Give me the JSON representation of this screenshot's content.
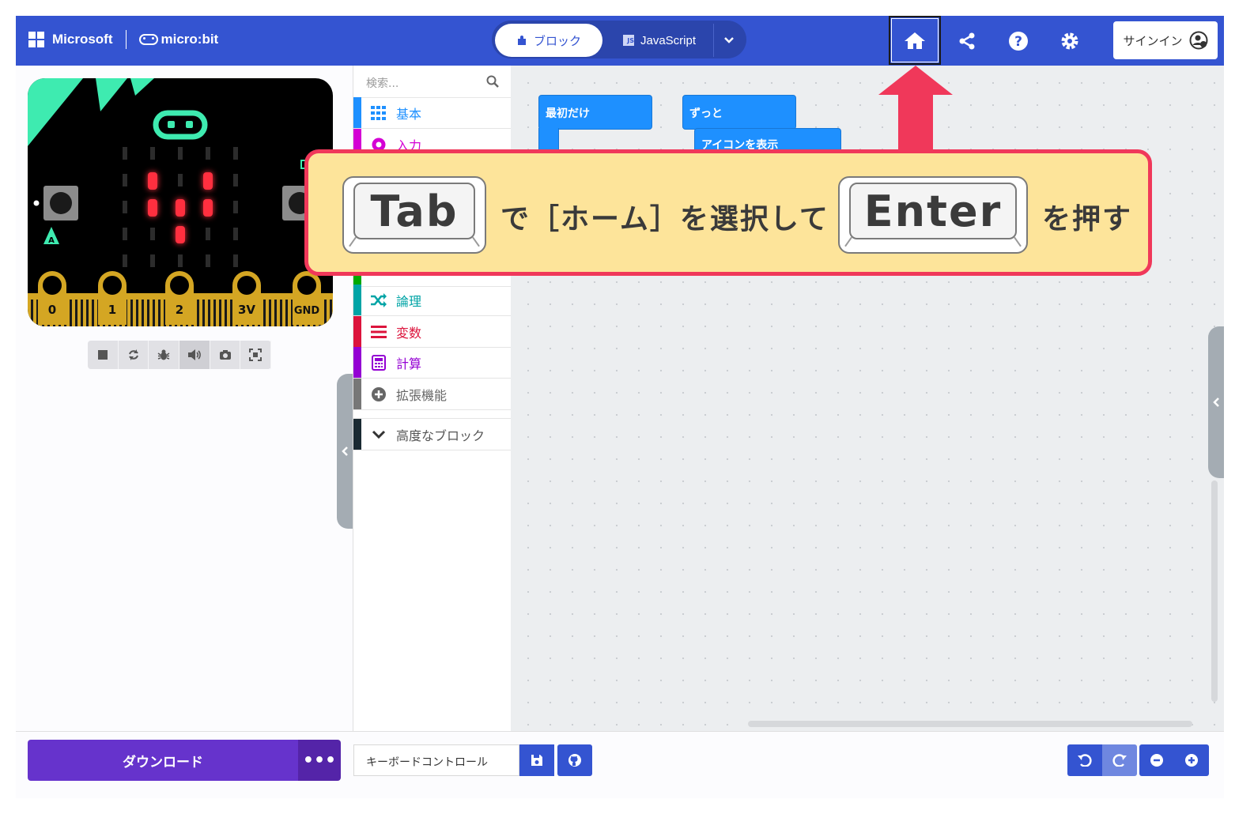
{
  "header": {
    "brand_microsoft": "Microsoft",
    "brand_microbit": "micro:bit",
    "tab_blocks": "ブロック",
    "tab_javascript": "JavaScript",
    "signin": "サインイン"
  },
  "simulator": {
    "pins": [
      "0",
      "1",
      "2",
      "3V",
      "GND"
    ],
    "button_a": "A",
    "led_grid": [
      [
        0,
        0,
        0,
        0,
        0
      ],
      [
        0,
        1,
        0,
        1,
        0
      ],
      [
        0,
        1,
        1,
        1,
        0
      ],
      [
        0,
        0,
        1,
        0,
        0
      ],
      [
        0,
        0,
        0,
        0,
        0
      ]
    ]
  },
  "toolbox": {
    "search_placeholder": "検索...",
    "categories": [
      {
        "label": "基本",
        "color": "#1e90ff"
      },
      {
        "label": "入力",
        "color": "#d400d4"
      },
      {
        "label": "論理",
        "color": "#00a4a6"
      },
      {
        "label": "変数",
        "color": "#dc143c"
      },
      {
        "label": "計算",
        "color": "#9400d3"
      },
      {
        "label": "拡張機能",
        "color": "#777777"
      },
      {
        "label": "高度なブロック",
        "color": "#333333"
      }
    ]
  },
  "workspace": {
    "block_on_start": "最初だけ",
    "block_forever": "ずっと",
    "block_show_icon": "アイコンを表示"
  },
  "bottom": {
    "download": "ダウンロード",
    "more": "•••",
    "project_name": "キーボードコントロール"
  },
  "callout": {
    "key1": "Tab",
    "text1": "で［ホーム］を選択して",
    "key2": "Enter",
    "text2": "を押す"
  },
  "colors": {
    "header": "#3454d1",
    "download": "#6633cc",
    "callout_border": "#f0385a",
    "callout_bg": "#fde49a"
  }
}
